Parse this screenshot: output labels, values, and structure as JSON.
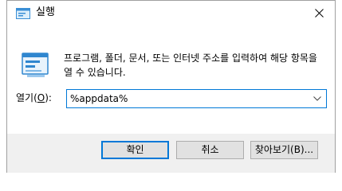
{
  "window": {
    "title": "실행",
    "close_glyph": "✕"
  },
  "description": "프로그램, 폴더, 문서, 또는 인터넷 주소를 입력하여 해당 항목을 열 수 있습니다.",
  "open": {
    "label_prefix": "열기(",
    "label_mnemonic": "O",
    "label_suffix": "):",
    "value": "%appdata%"
  },
  "buttons": {
    "ok": "확인",
    "cancel": "취소",
    "browse": "찾아보기(B)..."
  },
  "icons": {
    "title": "run-icon",
    "dialog": "run-icon",
    "close": "close-icon",
    "dropdown": "chevron-down-icon"
  },
  "colors": {
    "accent": "#0078d7",
    "footer": "#f0f0f0",
    "button": "#e1e1e1"
  }
}
